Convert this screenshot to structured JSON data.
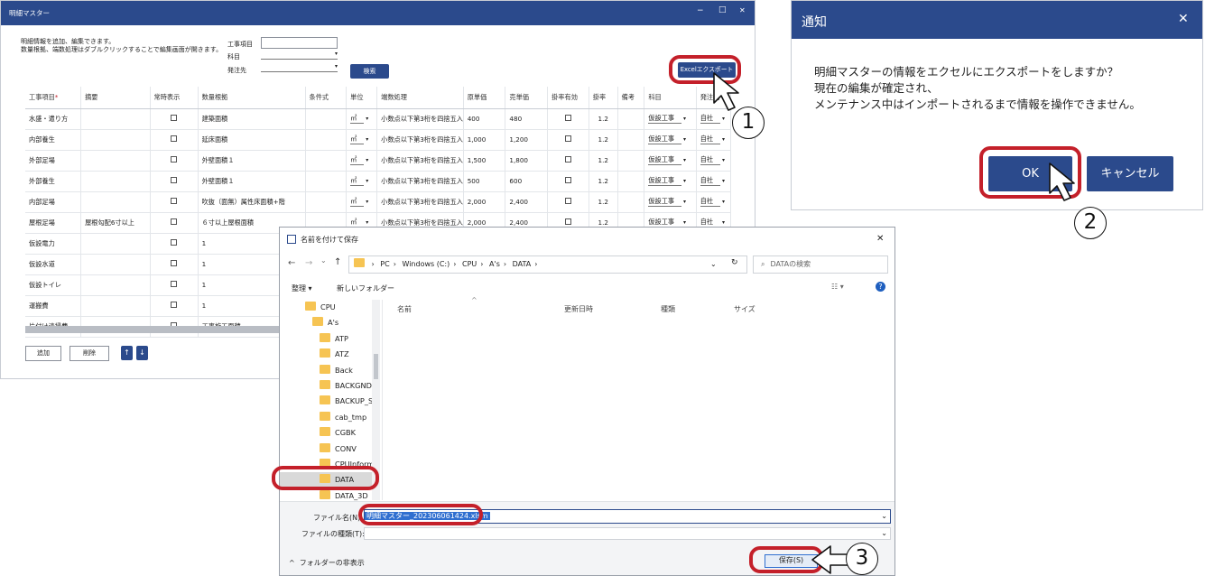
{
  "master": {
    "title": "明細マスター",
    "controls": [
      "−",
      "□",
      "✕"
    ],
    "desc1": "明細情報を追加、編集できます。",
    "desc2": "数量根拠、端数処理はダブルクリックすることで編集画面が開きます。",
    "filters": [
      {
        "label": "工事項目",
        "value": ""
      },
      {
        "label": "科目",
        "value": ""
      },
      {
        "label": "発注先",
        "value": ""
      }
    ],
    "search": "検索",
    "export": "Excelエクスポート",
    "columns": [
      "工事項目",
      "摘要",
      "常時表示",
      "数量根拠",
      "条件式",
      "単位",
      "端数処理",
      "原単価",
      "売単価",
      "掛率有効",
      "掛率",
      "備考",
      "科目",
      "発注先"
    ],
    "required_mark": "*",
    "rows": [
      {
        "item": "水盛・遣り方",
        "note": "",
        "basis": "建築面積",
        "unit": "㎡",
        "round": "小数点以下第3桁を四捨五入",
        "cost": "400",
        "sell": "480",
        "rate": "1.2",
        "subject": "仮設工事",
        "vendor": "自社"
      },
      {
        "item": "内部養生",
        "note": "",
        "basis": "延床面積",
        "unit": "㎡",
        "round": "小数点以下第3桁を四捨五入",
        "cost": "1,000",
        "sell": "1,200",
        "rate": "1.2",
        "subject": "仮設工事",
        "vendor": "自社"
      },
      {
        "item": "外部足場",
        "note": "",
        "basis": "外壁面積１",
        "unit": "㎡",
        "round": "小数点以下第3桁を四捨五入",
        "cost": "1,500",
        "sell": "1,800",
        "rate": "1.2",
        "subject": "仮設工事",
        "vendor": "自社"
      },
      {
        "item": "外部養生",
        "note": "",
        "basis": "外壁面積１",
        "unit": "㎡",
        "round": "小数点以下第3桁を四捨五入",
        "cost": "500",
        "sell": "600",
        "rate": "1.2",
        "subject": "仮設工事",
        "vendor": "自社"
      },
      {
        "item": "内部足場",
        "note": "",
        "basis": "吹抜（面無）属性床面積+階",
        "unit": "㎡",
        "round": "小数点以下第3桁を四捨五入",
        "cost": "2,000",
        "sell": "2,400",
        "rate": "1.2",
        "subject": "仮設工事",
        "vendor": "自社"
      },
      {
        "item": "屋根足場",
        "note": "屋根勾配6寸以上",
        "basis": "６寸以上屋根面積",
        "unit": "㎡",
        "round": "小数点以下第3桁を四捨五入",
        "cost": "2,000",
        "sell": "2,400",
        "rate": "1.2",
        "subject": "仮設工事",
        "vendor": "自社"
      },
      {
        "item": "仮設電力",
        "note": "",
        "basis": "1",
        "unit": "",
        "round": "",
        "cost": "",
        "sell": "",
        "rate": "",
        "subject": "",
        "vendor": ""
      },
      {
        "item": "仮設水道",
        "note": "",
        "basis": "1",
        "unit": "",
        "round": "",
        "cost": "",
        "sell": "",
        "rate": "",
        "subject": "",
        "vendor": ""
      },
      {
        "item": "仮設トイレ",
        "note": "",
        "basis": "1",
        "unit": "",
        "round": "",
        "cost": "",
        "sell": "",
        "rate": "",
        "subject": "",
        "vendor": ""
      },
      {
        "item": "運搬費",
        "note": "",
        "basis": "1",
        "unit": "",
        "round": "",
        "cost": "",
        "sell": "",
        "rate": "",
        "subject": "",
        "vendor": ""
      },
      {
        "item": "片付け清掃費",
        "note": "",
        "basis": "工事施工面積",
        "unit": "",
        "round": "",
        "cost": "",
        "sell": "",
        "rate": "",
        "subject": "",
        "vendor": ""
      }
    ],
    "add": "追加",
    "delete": "削除",
    "up": "↑",
    "down": "↓"
  },
  "notice": {
    "title": "通知",
    "close": "✕",
    "line1": "明細マスターの情報をエクセルにエクスポートをしますか？",
    "line2": "現在の編集が確定され、",
    "line3": "メンテナンス中はインポートされるまで情報を操作できません。",
    "ok": "OK",
    "cancel": "キャンセル"
  },
  "save": {
    "title": "名前を付けて保存",
    "close": "✕",
    "nav": [
      "←",
      "→",
      "⌄",
      "↑"
    ],
    "path": [
      "PC",
      "Windows (C:)",
      "CPU",
      "A's",
      "DATA"
    ],
    "refresh": "↻",
    "search_placeholder": "DATAの検索",
    "organize": "整理 ▾",
    "new_folder": "新しいフォルダー",
    "tree": [
      {
        "name": "CPU",
        "indent": 0
      },
      {
        "name": "A's",
        "indent": 1
      },
      {
        "name": "ATP",
        "indent": 2
      },
      {
        "name": "ATZ",
        "indent": 2
      },
      {
        "name": "Back",
        "indent": 2
      },
      {
        "name": "BACKGND",
        "indent": 2
      },
      {
        "name": "BACKUP_S",
        "indent": 2
      },
      {
        "name": "cab_tmp",
        "indent": 2
      },
      {
        "name": "CGBK",
        "indent": 2
      },
      {
        "name": "CONV",
        "indent": 2
      },
      {
        "name": "CPUInforma",
        "indent": 2
      },
      {
        "name": "DATA",
        "indent": 2
      },
      {
        "name": "DATA_3D",
        "indent": 2
      }
    ],
    "cols": [
      "名前",
      "更新日時",
      "種類",
      "サイズ"
    ],
    "filename_label": "ファイル名(N):",
    "filename": "明細マスター_202306061424.xlsm",
    "filetype_label": "ファイルの種類(T):",
    "filetype": "",
    "hide_folders": "フォルダーの非表示",
    "save_btn": "保存(S)"
  },
  "callouts": [
    "1",
    "2",
    "3"
  ],
  "colors": {
    "accent": "#2b4a8c",
    "highlight": "#c4202a"
  }
}
